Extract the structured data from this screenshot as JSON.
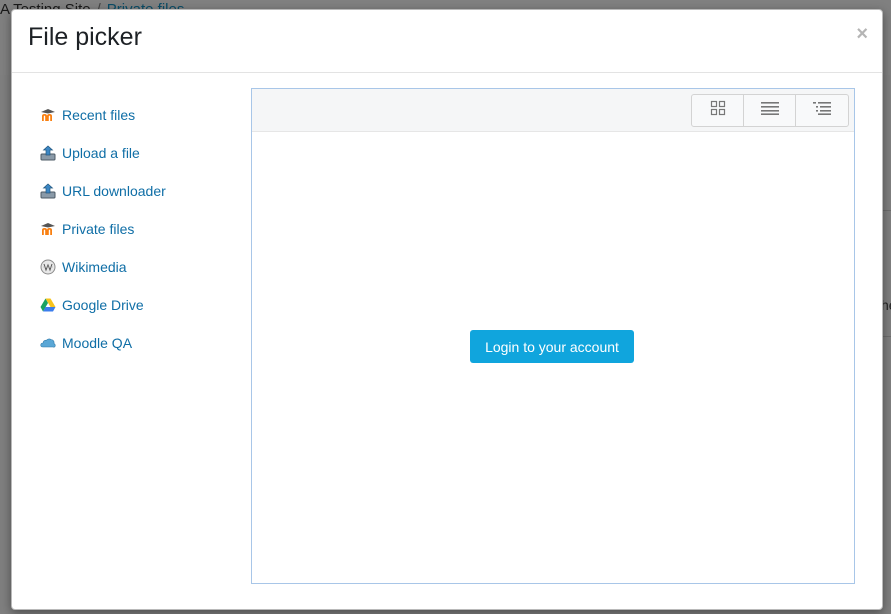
{
  "background": {
    "breadcrumb": {
      "site": "A Testing Site",
      "separator": "/",
      "current": "Private files"
    },
    "right_fragment": "he"
  },
  "modal": {
    "title": "File picker",
    "close_glyph": "×"
  },
  "repositories": [
    {
      "label": "Recent files",
      "icon": "moodle-icon"
    },
    {
      "label": "Upload a file",
      "icon": "upload-icon"
    },
    {
      "label": "URL downloader",
      "icon": "upload-icon"
    },
    {
      "label": "Private files",
      "icon": "moodle-icon"
    },
    {
      "label": "Wikimedia",
      "icon": "wikipedia-icon"
    },
    {
      "label": "Google Drive",
      "icon": "google-drive-icon"
    },
    {
      "label": "Moodle QA",
      "icon": "cloud-icon"
    }
  ],
  "toolbar": {
    "views": [
      "icons-view",
      "list-view",
      "tree-view"
    ]
  },
  "content": {
    "login_button": "Login to your account"
  },
  "colors": {
    "link": "#0f6ea6",
    "primary_button": "#10a5dd",
    "panel_border": "#a8c6e8"
  }
}
